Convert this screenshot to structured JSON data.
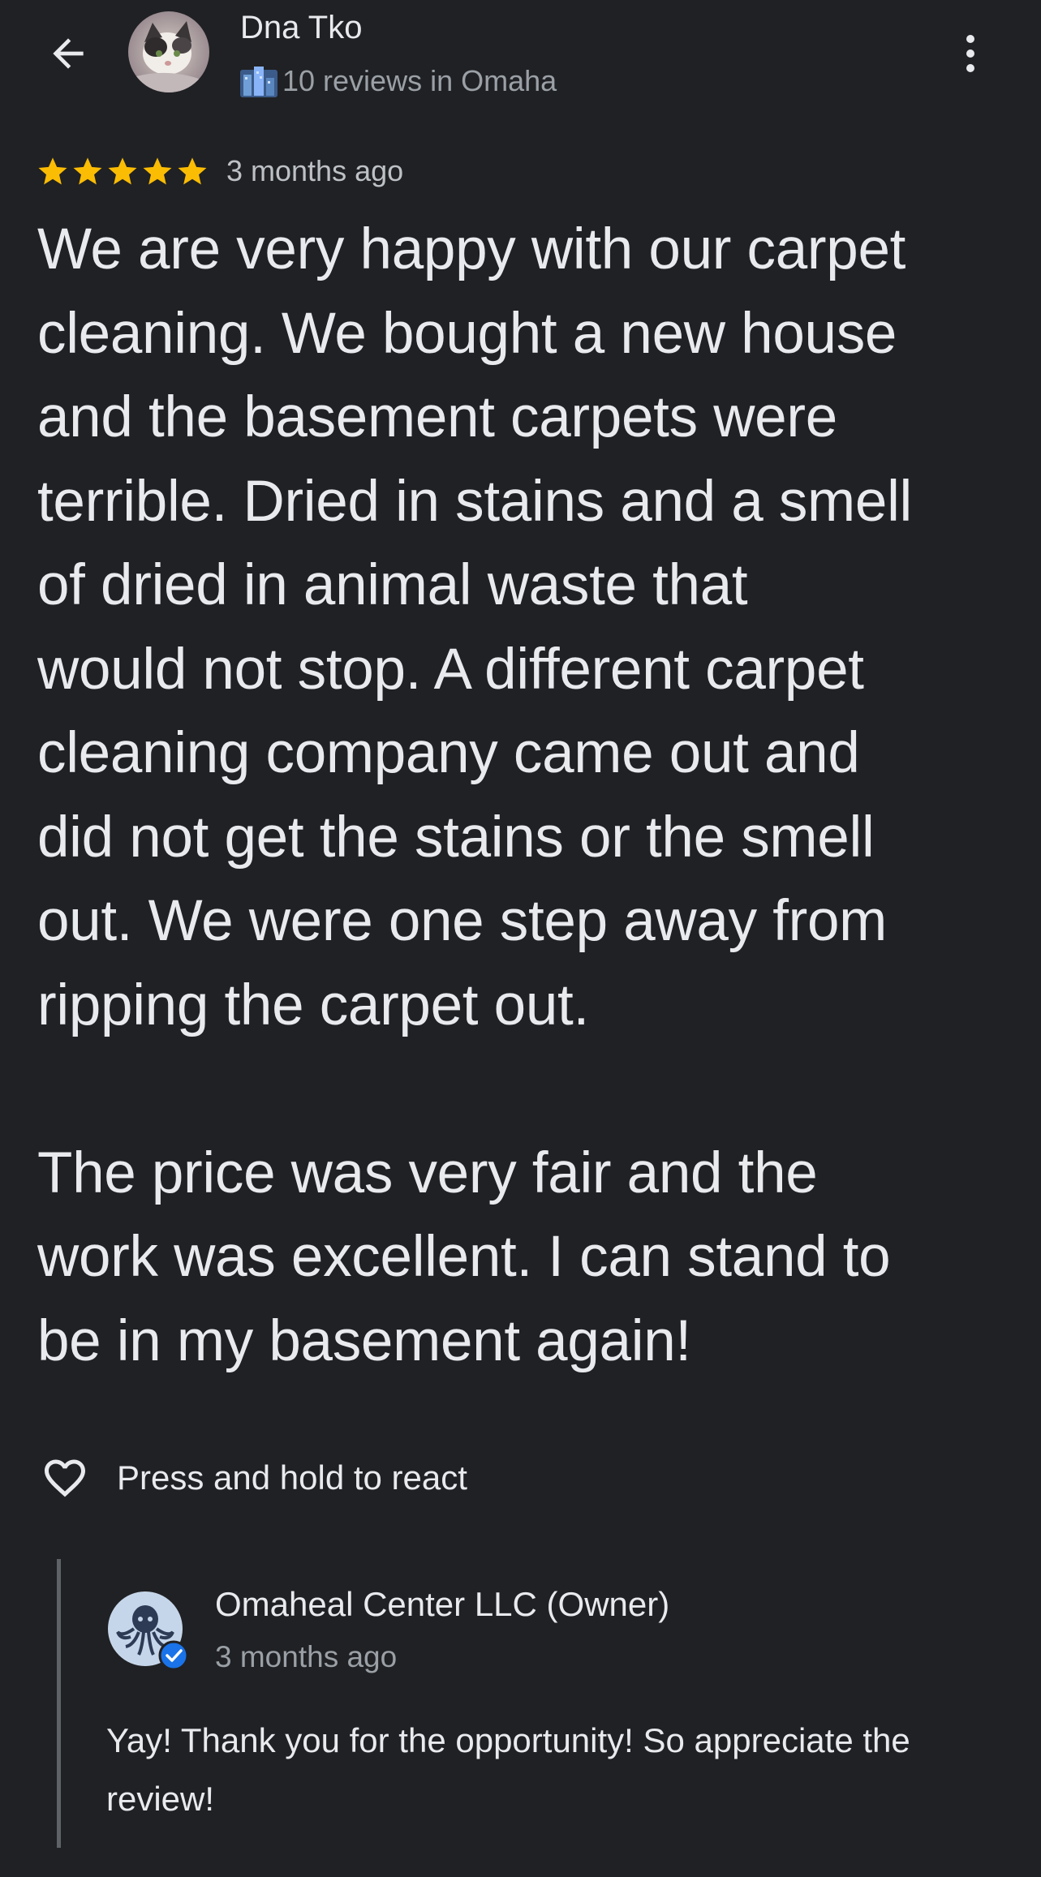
{
  "reviewer": {
    "name": "Dna Tko",
    "meta": "10 reviews in Omaha"
  },
  "review": {
    "rating": 5,
    "rating_max": 5,
    "date": "3 months ago",
    "lines": [
      "We are very happy with our carpet",
      "cleaning. We bought a new house",
      "and the basement carpets were",
      "terrible. Dried in stains and a smell",
      "of dried in animal waste that",
      "would not stop. A different carpet",
      "cleaning company came out and",
      "did not get the stains or the smell",
      "out. We were one step away from",
      "ripping the carpet out.",
      "",
      "The price was very fair and the",
      "work was excellent. I can stand to",
      "be in my basement again!"
    ]
  },
  "react": {
    "label": "Press and hold to react"
  },
  "owner_reply": {
    "name": "Omaheal Center LLC (Owner)",
    "date": "3 months ago",
    "lines": [
      "Yay! Thank you for the opportunity! So appreciate the",
      "review!"
    ]
  },
  "icons": {
    "back": "arrow-back-icon",
    "more": "more-vert-icon",
    "star": "star-icon",
    "heart": "heart-outline-icon",
    "verified": "verified-badge-icon",
    "local_guide": "local-guide-icon"
  },
  "colors": {
    "background": "#202124",
    "text_primary": "#e8eaed",
    "text_secondary": "#9aa0a6",
    "star": "#fbbc04",
    "verified": "#1a73e8",
    "reply_rule": "#5f6368"
  }
}
